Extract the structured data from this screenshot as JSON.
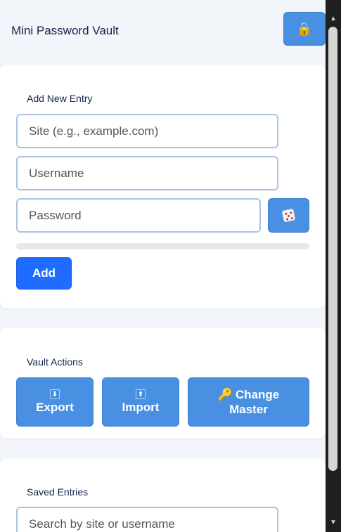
{
  "app": {
    "title": "Mini Password Vault"
  },
  "header": {
    "lock_icon": "lock-icon"
  },
  "add_entry": {
    "title": "Add New Entry",
    "site_placeholder": "Site (e.g., example.com)",
    "username_placeholder": "Username",
    "password_placeholder": "Password",
    "generate_icon": "dice-icon",
    "strength_level": 0,
    "add_label": "Add"
  },
  "vault_actions": {
    "title": "Vault Actions",
    "export_label": "Export",
    "import_label": "Import",
    "change_master_label_line1": "Change",
    "change_master_label_line2": "Master"
  },
  "saved_entries": {
    "title": "Saved Entries",
    "search_placeholder": "Search by site or username"
  },
  "colors": {
    "accent": "#4a90e2",
    "primary": "#1f6dff",
    "background": "#f2f5f9",
    "title_text": "#14244a"
  }
}
